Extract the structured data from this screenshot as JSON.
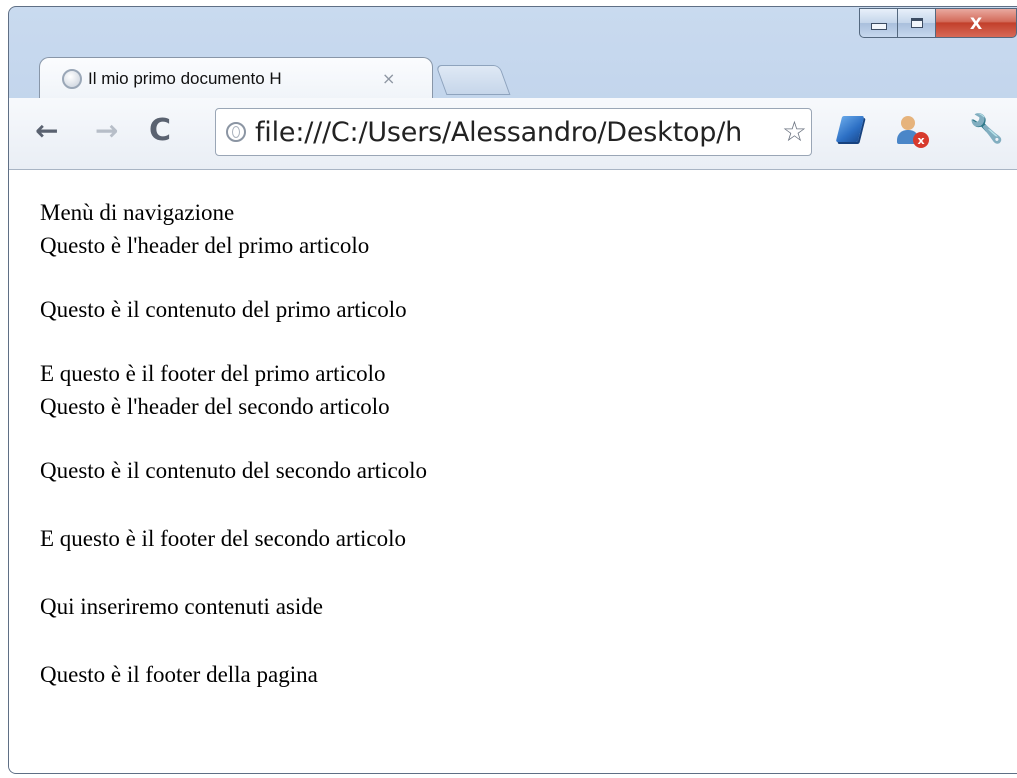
{
  "browser": {
    "tab": {
      "title": "Il mio primo documento H",
      "close": "×"
    },
    "toolbar": {
      "back": "←",
      "forward": "→",
      "reload": "C",
      "url": "file:///C:/Users/Alessandro/Desktop/h",
      "bookmark_star": "☆",
      "wrench": "🔧"
    },
    "window_controls": {
      "close": "X"
    }
  },
  "page": {
    "lines": [
      "Menù di navigazione",
      "Questo è l'header del primo articolo",
      "Questo è il contenuto del primo articolo",
      "E questo è il footer del primo articolo",
      "Questo è l'header del secondo articolo",
      "Questo è il contenuto del secondo articolo",
      "E questo è il footer del secondo articolo",
      "Qui inseriremo contenuti aside",
      "Questo è il footer della pagina"
    ]
  }
}
